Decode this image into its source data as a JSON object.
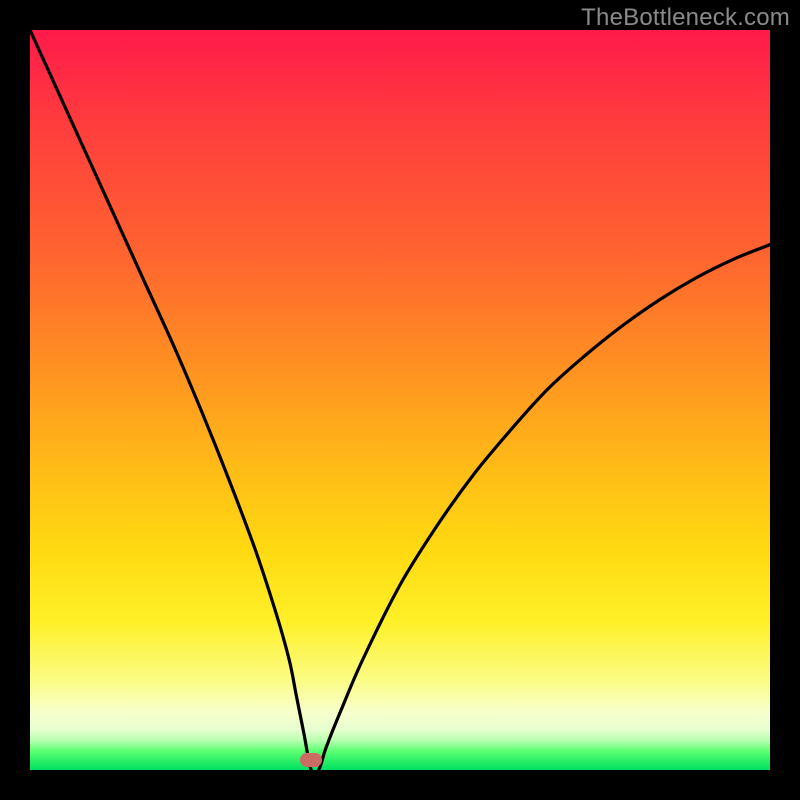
{
  "watermark": "TheBottleneck.com",
  "marker": {
    "x_pct": 38.0,
    "y_pct": 98.6
  },
  "chart_data": {
    "type": "line",
    "title": "",
    "xlabel": "",
    "ylabel": "",
    "xlim": [
      0,
      100
    ],
    "ylim": [
      0,
      100
    ],
    "grid": false,
    "legend": false,
    "series": [
      {
        "name": "bottleneck-curve",
        "x": [
          0,
          5,
          10,
          15,
          20,
          25,
          30,
          33,
          35,
          36,
          37,
          38,
          39,
          40,
          42,
          45,
          50,
          55,
          60,
          65,
          70,
          75,
          80,
          85,
          90,
          95,
          100
        ],
        "y": [
          100,
          89,
          78,
          67,
          56,
          44,
          31,
          22,
          15,
          10,
          5,
          0,
          0,
          3,
          8,
          15,
          25,
          33,
          40,
          46,
          51.5,
          56,
          60,
          63.5,
          66.5,
          69,
          71
        ]
      }
    ],
    "annotations": [
      {
        "kind": "marker",
        "x": 38,
        "y": 0,
        "shape": "rounded-pill",
        "color": "#cc6b63"
      }
    ],
    "background_gradient": {
      "direction": "vertical",
      "stops": [
        {
          "pos": 0.0,
          "color": "#ff1a4a"
        },
        {
          "pos": 0.45,
          "color": "#ff8f22"
        },
        {
          "pos": 0.8,
          "color": "#fff028"
        },
        {
          "pos": 0.95,
          "color": "#e8ffd0"
        },
        {
          "pos": 1.0,
          "color": "#00e060"
        }
      ]
    }
  }
}
